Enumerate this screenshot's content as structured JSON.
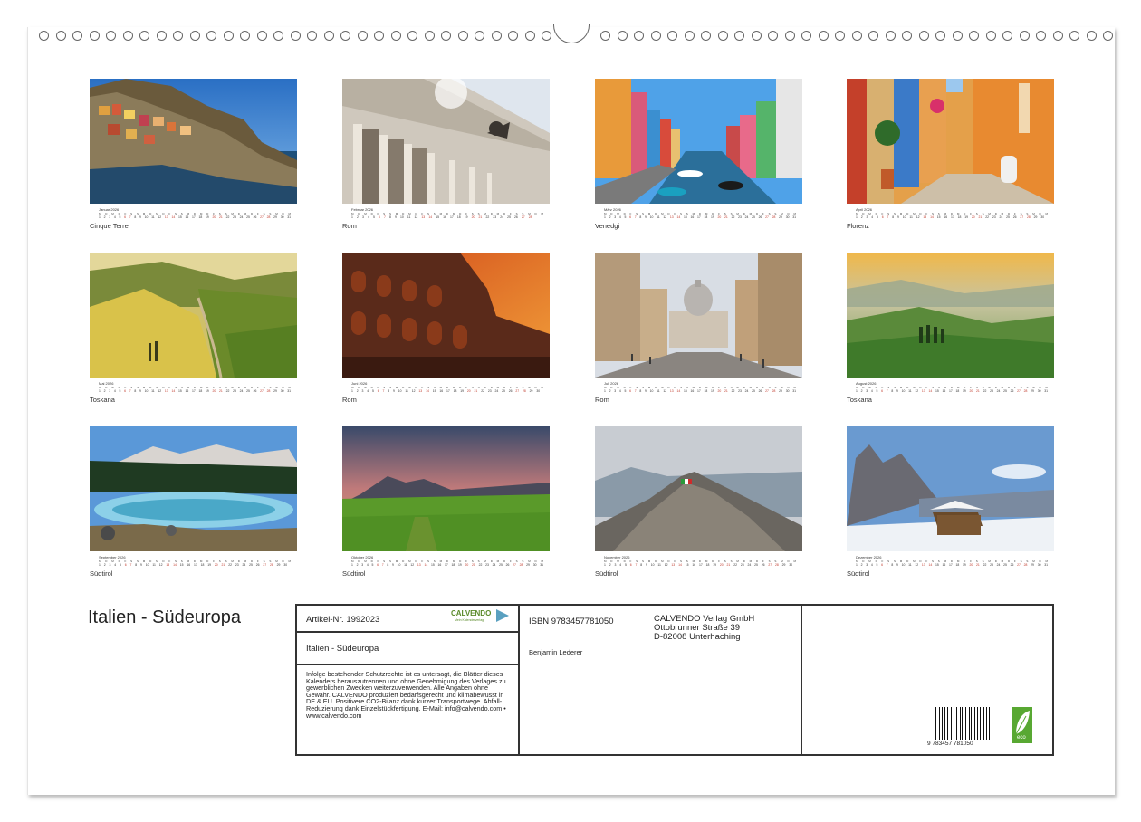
{
  "calendar_title": "Italien - Südeuropa",
  "weekday_letters": [
    "M",
    "D",
    "M",
    "D",
    "F",
    "S",
    "S",
    "M",
    "D",
    "M",
    "D",
    "F",
    "S",
    "S",
    "M",
    "D",
    "M",
    "D",
    "F",
    "S",
    "S",
    "M",
    "D",
    "M",
    "D",
    "F",
    "S",
    "S",
    "M",
    "D",
    "M"
  ],
  "months": [
    {
      "name": "Januar 2026",
      "location": "Cinque Terre",
      "days": 31
    },
    {
      "name": "Februar 2026",
      "location": "Rom",
      "days": 28
    },
    {
      "name": "März 2026",
      "location": "Venedgi",
      "days": 31
    },
    {
      "name": "April 2026",
      "location": "Florenz",
      "days": 30
    },
    {
      "name": "Mai 2026",
      "location": "Toskana",
      "days": 31
    },
    {
      "name": "Juni 2026",
      "location": "Rom",
      "days": 30
    },
    {
      "name": "Juli 2026",
      "location": "Rom",
      "days": 31
    },
    {
      "name": "August 2026",
      "location": "Toskana",
      "days": 31
    },
    {
      "name": "September 2026",
      "location": "Südtirol",
      "days": 30
    },
    {
      "name": "Oktober 2026",
      "location": "Südtirol",
      "days": 31
    },
    {
      "name": "November 2026",
      "location": "Südtirol",
      "days": 30
    },
    {
      "name": "Dezember 2026",
      "location": "Südtirol",
      "days": 31
    }
  ],
  "info": {
    "article": "Artikel-Nr. 1992023",
    "brand": "CALVENDO",
    "brand_sub": "Mein Kalenderverlag",
    "title": "Italien - Südeuropa",
    "legal": "Infolge bestehender Schutzrechte ist es untersagt, die Blätter dieses Kalenders herauszutrennen und ohne Genehmigung des Verlages zu gewerblichen Zwecken weiterzuverwenden. Alle Angaben ohne Gewähr. CALVENDO produziert bedarfsgerecht und klimabewusst in DE & EU. Positivere CO2-Bilanz dank kurzer Transportwege. Abfall-Reduzierung dank Einzelstückfertigung. E-Mail: info@calvendo.com • www.calvendo.com",
    "isbn": "ISBN 9783457781050",
    "author": "Benjamin Lederer",
    "publisher_1": "CALVENDO Verlag GmbH",
    "publisher_2": "Ottobrunner Straße 39",
    "publisher_3": "D-82008 Unterhaching",
    "barcode_digits": "9  783457  781050",
    "eco_label": "eco"
  },
  "colors": {
    "weekend": "#c0392b",
    "eco": "#58a832"
  }
}
